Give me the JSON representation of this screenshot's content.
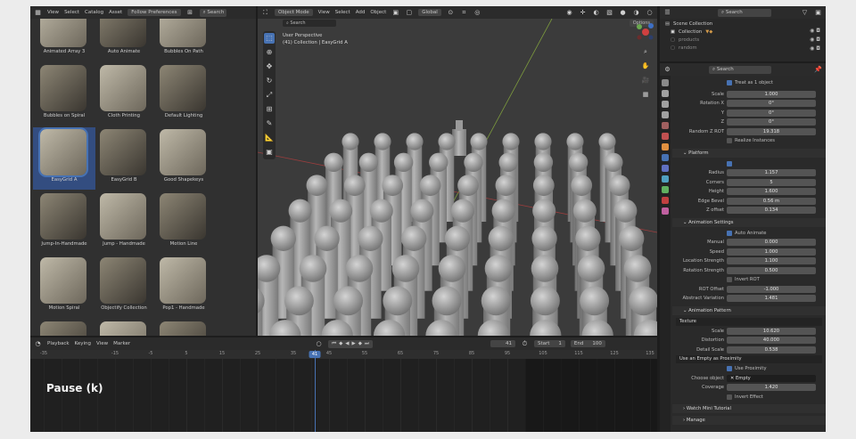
{
  "asset_browser": {
    "menus": [
      "View",
      "Select",
      "Catalog",
      "Asset"
    ],
    "library_dropdown": "Follow Preferences",
    "search_placeholder": "Search",
    "assets": [
      {
        "label": "Animated Array 3",
        "selected": false
      },
      {
        "label": "Auto Animate",
        "selected": false
      },
      {
        "label": "Bubbles On Path",
        "selected": false
      },
      {
        "label": "Bubbles on Spiral",
        "selected": false
      },
      {
        "label": "Cloth Printing",
        "selected": false
      },
      {
        "label": "Default Lighting",
        "selected": false
      },
      {
        "label": "EasyGrid A",
        "selected": true
      },
      {
        "label": "EasyGrid B",
        "selected": false
      },
      {
        "label": "Good Shapekeys",
        "selected": false
      },
      {
        "label": "Jump-In-Handmade",
        "selected": false
      },
      {
        "label": "Jump - Handmade",
        "selected": false
      },
      {
        "label": "Motion Line",
        "selected": false
      },
      {
        "label": "Motion Spiral",
        "selected": false
      },
      {
        "label": "Objectify Collection",
        "selected": false
      },
      {
        "label": "Pop1 - Handmade",
        "selected": false
      },
      {
        "label": "",
        "selected": false
      },
      {
        "label": "",
        "selected": false
      },
      {
        "label": "",
        "selected": false
      }
    ]
  },
  "viewport": {
    "mode": "Object Mode",
    "menus": [
      "View",
      "Select",
      "Add",
      "Object"
    ],
    "orientation": "Global",
    "options_label": "Options",
    "overlay_line1": "User Perspective",
    "overlay_line2": "(41) Collection | EasyGrid A"
  },
  "timeline": {
    "menus": [
      "Playback",
      "Keying",
      "View",
      "Marker"
    ],
    "current_frame": "41",
    "start_label": "Start",
    "start_value": "1",
    "end_label": "End",
    "end_value": "100",
    "ruler": [
      "-35",
      "-15",
      "-5",
      "5",
      "15",
      "25",
      "35",
      "41",
      "45",
      "55",
      "65",
      "75",
      "85",
      "95",
      "105",
      "115",
      "125",
      "135"
    ],
    "overlay_text": "Pause (k)"
  },
  "outliner": {
    "search_placeholder": "Search",
    "scene_collection": "Scene Collection",
    "items": [
      "Collection",
      "products",
      "random"
    ]
  },
  "properties": {
    "search_placeholder": "Search",
    "treat_as_one": "Treat as 1 object",
    "rows1": [
      {
        "label": "Scale",
        "value": "1.000"
      },
      {
        "label": "Rotation X",
        "value": "0°"
      },
      {
        "label": "Y",
        "value": "0°"
      },
      {
        "label": "Z",
        "value": "0°"
      },
      {
        "label": "Random Z ROT",
        "value": "19.318"
      }
    ],
    "realize_instances": "Realize Instances",
    "platform_section": "Platform",
    "platform_rows": [
      {
        "label": "Radius",
        "value": "1.157"
      },
      {
        "label": "Corners",
        "value": "5"
      },
      {
        "label": "Height",
        "value": "1.600"
      },
      {
        "label": "Edge Bevel",
        "value": "0.56 m"
      },
      {
        "label": "Z offset",
        "value": "0.134"
      }
    ],
    "animation_section": "Animation Settings",
    "auto_animate": "Auto Animate",
    "animation_rows": [
      {
        "label": "Manual",
        "value": "0.000"
      },
      {
        "label": "Speed",
        "value": "1.000"
      },
      {
        "label": "Location Strength",
        "value": "1.100"
      },
      {
        "label": "Rotation Strength",
        "value": "0.500"
      }
    ],
    "invert_rot": "Invert ROT",
    "animation_rows2": [
      {
        "label": "ROT Offset",
        "value": "-1.000"
      },
      {
        "label": "Abstract Variation",
        "value": "1.481"
      }
    ],
    "pattern_section": "Animation Pattern",
    "texture_label": "Texture",
    "pattern_rows": [
      {
        "label": "Scale",
        "value": "10.620"
      },
      {
        "label": "Distortion",
        "value": "40.000"
      },
      {
        "label": "Detail Scale",
        "value": "0.538"
      }
    ],
    "empty_proximity_label": "Use an Empty as Proximity",
    "use_proximity": "Use Proximity",
    "choose_object_label": "Choose object",
    "choose_object_value": "Empty",
    "coverage_label": "Coverage",
    "coverage_value": "1.420",
    "invert_effect": "Invert Effect",
    "watch_tutorial": "Watch Mini Tutorial",
    "manage": "Manage"
  },
  "colors": {
    "accent": "#4772b3",
    "panel": "#2a2a2a",
    "viewport_bg": "#3b3b3b"
  }
}
